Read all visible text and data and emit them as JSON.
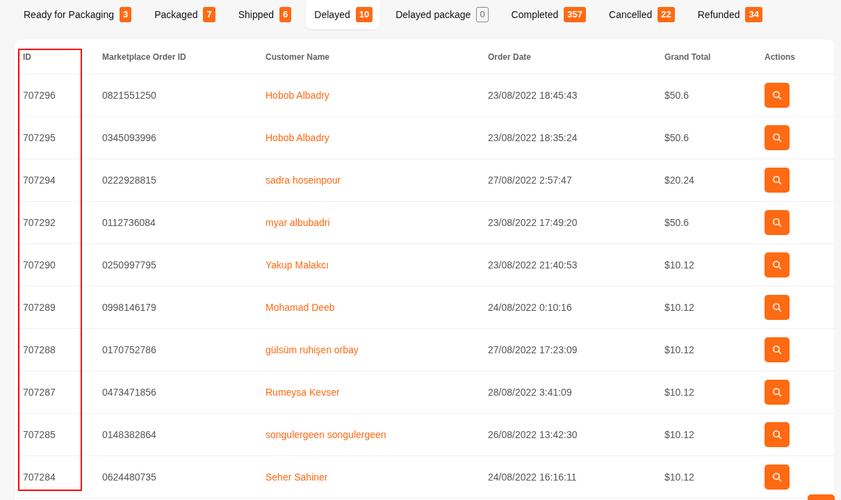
{
  "tabs": [
    {
      "label": "Ready for Packaging",
      "count": "3",
      "kind": "filled",
      "selected": false
    },
    {
      "label": "Packaged",
      "count": "7",
      "kind": "filled",
      "selected": false
    },
    {
      "label": "Shipped",
      "count": "6",
      "kind": "filled",
      "selected": false
    },
    {
      "label": "Delayed",
      "count": "10",
      "kind": "filled",
      "selected": true
    },
    {
      "label": "Delayed package",
      "count": "0",
      "kind": "outline",
      "selected": false
    },
    {
      "label": "Completed",
      "count": "357",
      "kind": "filled",
      "selected": false
    },
    {
      "label": "Cancelled",
      "count": "22",
      "kind": "filled",
      "selected": false
    },
    {
      "label": "Refunded",
      "count": "34",
      "kind": "filled",
      "selected": false
    }
  ],
  "table": {
    "columns": [
      "ID",
      "Marketplace Order ID",
      "Customer Name",
      "Order Date",
      "Grand Total",
      "Actions"
    ],
    "rows": [
      {
        "id": "707296",
        "marketplace_order_id": "0821551250",
        "customer": "Hobob Albadry",
        "date": "23/08/2022 18:45:43",
        "total": "$50.6"
      },
      {
        "id": "707295",
        "marketplace_order_id": "0345093996",
        "customer": "Hobob Albadry",
        "date": "23/08/2022 18:35:24",
        "total": "$50.6"
      },
      {
        "id": "707294",
        "marketplace_order_id": "0222928815",
        "customer": "sadra hoseinpour",
        "date": "27/08/2022 2:57:47",
        "total": "$20.24"
      },
      {
        "id": "707292",
        "marketplace_order_id": "0112736084",
        "customer": "myar albubadri",
        "date": "23/08/2022 17:49:20",
        "total": "$50.6"
      },
      {
        "id": "707290",
        "marketplace_order_id": "0250997795",
        "customer": "Yakup Malakcı",
        "date": "23/08/2022 21:40:53",
        "total": "$10.12"
      },
      {
        "id": "707289",
        "marketplace_order_id": "0998146179",
        "customer": "Mohamad Deeb",
        "date": "24/08/2022 0:10:16",
        "total": "$10.12"
      },
      {
        "id": "707288",
        "marketplace_order_id": "0170752786",
        "customer": "gülsüm ruhişen orbay",
        "date": "27/08/2022 17:23:09",
        "total": "$10.12"
      },
      {
        "id": "707287",
        "marketplace_order_id": "0473471856",
        "customer": "Rumeysa Kevser",
        "date": "28/08/2022 3:41:09",
        "total": "$10.12"
      },
      {
        "id": "707285",
        "marketplace_order_id": "0148382864",
        "customer": "songulergeen songulergeen",
        "date": "26/08/2022 13:42:30",
        "total": "$10.12"
      },
      {
        "id": "707284",
        "marketplace_order_id": "0624480735",
        "customer": "Seher Sahiner",
        "date": "24/08/2022 16:16:11",
        "total": "$10.12"
      }
    ]
  }
}
